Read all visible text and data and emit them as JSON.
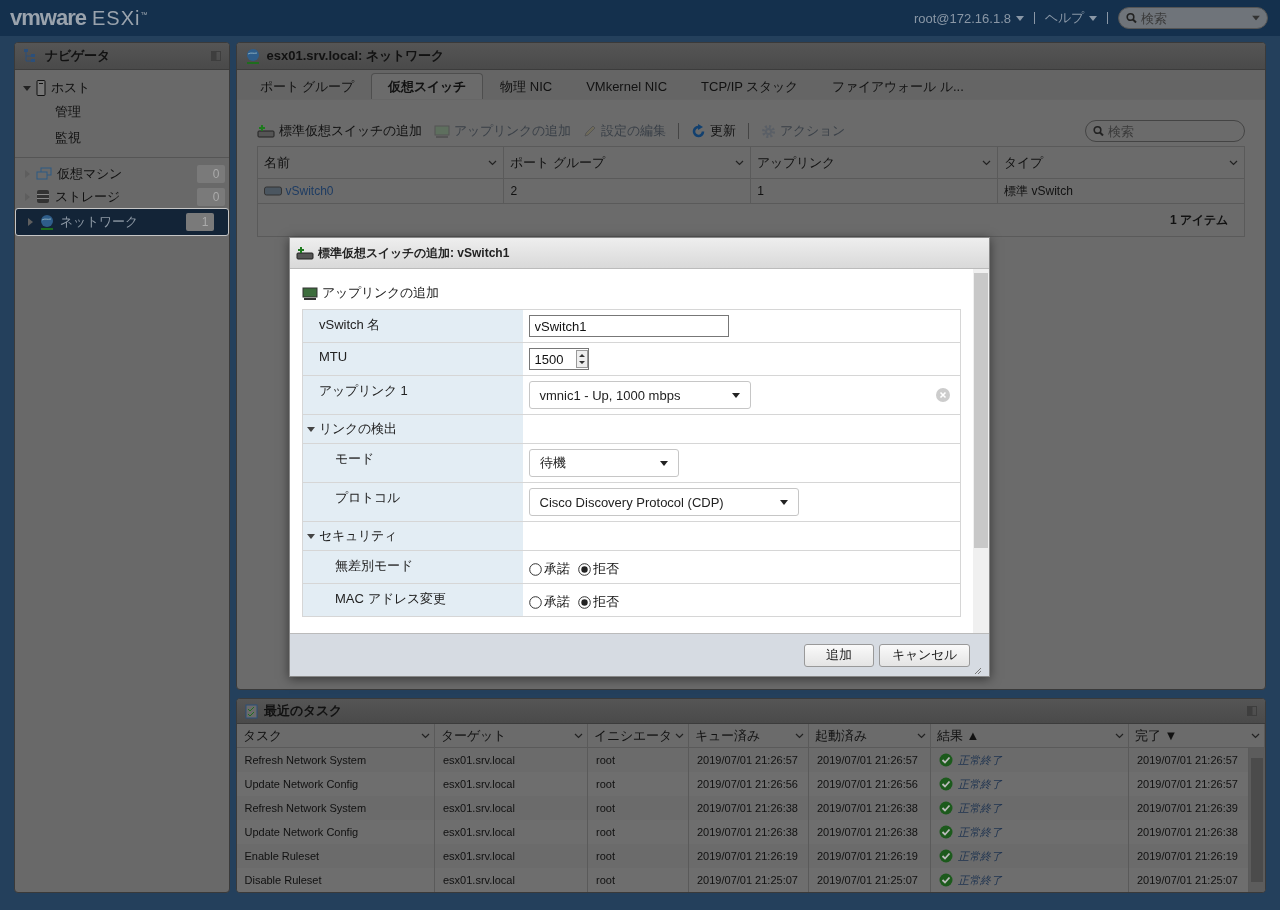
{
  "header": {
    "brand": "vmware",
    "product": "ESXi",
    "trademark": "™",
    "user": "root@172.16.1.8",
    "help": "ヘルプ",
    "search": {
      "placeholder": "検索"
    }
  },
  "navigator": {
    "title": "ナビゲータ",
    "items": [
      {
        "label": "ホスト",
        "kind": "host",
        "expanded": true,
        "selected": false,
        "children": [
          {
            "label": "管理",
            "selected": false
          },
          {
            "label": "監視",
            "selected": false
          }
        ]
      },
      {
        "label": "仮想マシン",
        "kind": "vm",
        "expanded": false,
        "selected": false,
        "count": "0"
      },
      {
        "label": "ストレージ",
        "kind": "storage",
        "expanded": false,
        "selected": false,
        "count": "0"
      },
      {
        "label": "ネットワーク",
        "kind": "network",
        "expanded": false,
        "selected": true,
        "count": "1"
      }
    ]
  },
  "content": {
    "title": "esx01.srv.local: ネットワーク",
    "tabs": [
      {
        "label": "ポート グループ",
        "selected": false
      },
      {
        "label": "仮想スイッチ",
        "selected": true
      },
      {
        "label": "物理 NIC",
        "selected": false
      },
      {
        "label": "VMkernel NIC",
        "selected": false
      },
      {
        "label": "TCP/IP スタック",
        "selected": false
      },
      {
        "label": "ファイアウォール ル...",
        "selected": false
      }
    ],
    "toolbar": [
      {
        "label": "標準仮想スイッチの追加",
        "kind": "add-switch",
        "disabled": false,
        "separated": false
      },
      {
        "label": "アップリンクの追加",
        "kind": "uplink",
        "disabled": true,
        "separated": false
      },
      {
        "label": "設定の編集",
        "kind": "pencil",
        "disabled": true,
        "separated": false
      },
      {
        "label": "更新",
        "kind": "refresh",
        "disabled": false,
        "separated": true
      },
      {
        "label": "アクション",
        "kind": "gear",
        "disabled": true,
        "separated": true
      }
    ],
    "search": {
      "placeholder": "検索"
    },
    "table": {
      "columns": [
        "名前",
        "ポート グループ",
        "アップリンク",
        "タイプ"
      ],
      "rows": [
        {
          "cells": [
            "vSwitch0",
            "2",
            "1",
            "標準 vSwitch"
          ]
        }
      ],
      "footer": "1 アイテム"
    }
  },
  "dialog": {
    "title": "標準仮想スイッチの追加: vSwitch1",
    "section": "アップリンクの追加",
    "rows": [
      {
        "kind": "text",
        "label": "vSwitch 名",
        "value": "vSwitch1"
      },
      {
        "kind": "spinner",
        "label": "MTU",
        "value": "1500"
      },
      {
        "kind": "select",
        "label": "アップリンク 1",
        "value": "vmnic1 - Up, 1000 mbps",
        "removable": true
      },
      {
        "kind": "group",
        "label": "リンクの検出",
        "expanded": true,
        "children": [
          {
            "kind": "select",
            "label": "モード",
            "value": "待機"
          },
          {
            "kind": "select",
            "label": "プロトコル",
            "value": "Cisco Discovery Protocol (CDP)"
          }
        ]
      },
      {
        "kind": "group",
        "label": "セキュリティ",
        "expanded": true,
        "children": [
          {
            "kind": "radio",
            "label": "無差別モード",
            "options": [
              {
                "label": "承諾",
                "selected": false
              },
              {
                "label": "拒否",
                "selected": true
              }
            ]
          },
          {
            "kind": "radio",
            "label": "MAC アドレス変更",
            "options": [
              {
                "label": "承諾",
                "selected": false
              },
              {
                "label": "拒否",
                "selected": true
              }
            ]
          }
        ]
      }
    ],
    "buttons": [
      "追加",
      "キャンセル"
    ]
  },
  "tasks": {
    "title": "最近のタスク",
    "columns": [
      "タスク",
      "ターゲット",
      "イニシエータ",
      "キュー済み",
      "起動済み",
      "結果 ▲",
      "完了 ▼"
    ],
    "rows": [
      {
        "task": "Refresh Network System",
        "target": "esx01.srv.local",
        "initiator": "root",
        "queued": "2019/07/01 21:26:57",
        "started": "2019/07/01 21:26:57",
        "result": "正常終了",
        "kind": "success",
        "completed": "2019/07/01 21:26:57"
      },
      {
        "task": "Update Network Config",
        "target": "esx01.srv.local",
        "initiator": "root",
        "queued": "2019/07/01 21:26:56",
        "started": "2019/07/01 21:26:56",
        "result": "正常終了",
        "kind": "success",
        "completed": "2019/07/01 21:26:57"
      },
      {
        "task": "Refresh Network System",
        "target": "esx01.srv.local",
        "initiator": "root",
        "queued": "2019/07/01 21:26:38",
        "started": "2019/07/01 21:26:38",
        "result": "正常終了",
        "kind": "success",
        "completed": "2019/07/01 21:26:39"
      },
      {
        "task": "Update Network Config",
        "target": "esx01.srv.local",
        "initiator": "root",
        "queued": "2019/07/01 21:26:38",
        "started": "2019/07/01 21:26:38",
        "result": "正常終了",
        "kind": "success",
        "completed": "2019/07/01 21:26:38"
      },
      {
        "task": "Enable Ruleset",
        "target": "esx01.srv.local",
        "initiator": "root",
        "queued": "2019/07/01 21:26:19",
        "started": "2019/07/01 21:26:19",
        "result": "正常終了",
        "kind": "success",
        "completed": "2019/07/01 21:26:19"
      },
      {
        "task": "Disable Ruleset",
        "target": "esx01.srv.local",
        "initiator": "root",
        "queued": "2019/07/01 21:25:07",
        "started": "2019/07/01 21:25:07",
        "result": "正常終了",
        "kind": "success",
        "completed": "2019/07/01 21:25:07"
      }
    ]
  }
}
